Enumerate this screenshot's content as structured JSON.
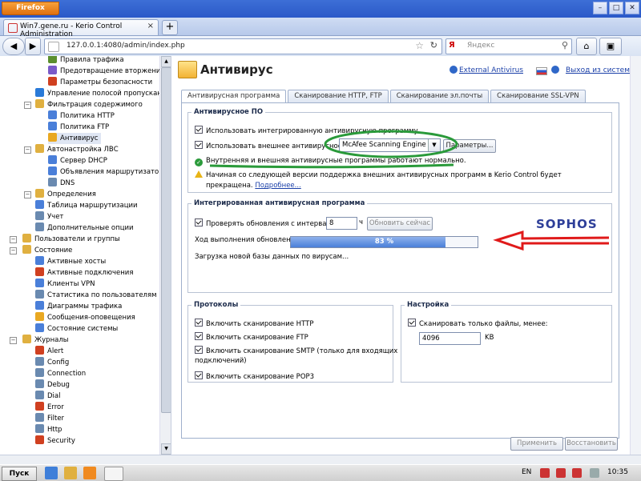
{
  "browser": {
    "button_label": "Firefox",
    "tab_title": "Win7.gene.ru - Kerio Control Administration",
    "url": "127.0.0.1:4080/admin/index.php",
    "search_placeholder": "Яндекс",
    "search_engine_letter": "Я"
  },
  "tree": {
    "items": [
      {
        "label": "Правила трафика",
        "color": "#5b8f2d"
      },
      {
        "label": "Предотвращение вторжения",
        "color": "#7a5ac8"
      },
      {
        "label": "Параметры безопасности",
        "color": "#d04020"
      },
      {
        "label": "Управление полосой пропускания и",
        "color": "#2a7ad8"
      },
      {
        "label": "Фильтрация содержимого",
        "color": "#e0b040"
      },
      {
        "label": "Политика HTTP",
        "color": "#4a7fd9"
      },
      {
        "label": "Политика FTP",
        "color": "#4a7fd9"
      },
      {
        "label": "Антивирус",
        "color": "#e9a821"
      },
      {
        "label": "Автонастройка ЛВС",
        "color": "#e0b040"
      },
      {
        "label": "Сервер DHCP",
        "color": "#4a7fd9"
      },
      {
        "label": "Объявления маршрутизатора IP",
        "color": "#4a7fd9"
      },
      {
        "label": "DNS",
        "color": "#6a8ab0"
      },
      {
        "label": "Определения",
        "color": "#e0b040"
      },
      {
        "label": "Таблица маршрутизации",
        "color": "#4a7fd9"
      },
      {
        "label": "Учет",
        "color": "#6a8ab0"
      },
      {
        "label": "Дополнительные опции",
        "color": "#6a8ab0"
      },
      {
        "label": "Пользователи и группы",
        "color": "#e0b040"
      },
      {
        "label": "Состояние",
        "color": "#e0b040"
      },
      {
        "label": "Активные хосты",
        "color": "#4a7fd9"
      },
      {
        "label": "Активные подключения",
        "color": "#d04020"
      },
      {
        "label": "Клиенты VPN",
        "color": "#4a7fd9"
      },
      {
        "label": "Статистика по пользователям",
        "color": "#6a8ab0"
      },
      {
        "label": "Диаграммы трафика",
        "color": "#4a7fd9"
      },
      {
        "label": "Сообщения-оповещения",
        "color": "#e9a821"
      },
      {
        "label": "Состояние системы",
        "color": "#4a7fd9"
      },
      {
        "label": "Журналы",
        "color": "#e0b040"
      },
      {
        "label": "Alert",
        "color": "#d04020"
      },
      {
        "label": "Config",
        "color": "#6a8ab0"
      },
      {
        "label": "Connection",
        "color": "#6a8ab0"
      },
      {
        "label": "Debug",
        "color": "#6a8ab0"
      },
      {
        "label": "Dial",
        "color": "#6a8ab0"
      },
      {
        "label": "Error",
        "color": "#d04020"
      },
      {
        "label": "Filter",
        "color": "#6a8ab0"
      },
      {
        "label": "Http",
        "color": "#6a8ab0"
      },
      {
        "label": "Security",
        "color": "#d04020"
      }
    ]
  },
  "page": {
    "title": "Антивирус",
    "external_antivirus_link": "External Antivirus",
    "logout_link": "Выход из системы"
  },
  "tabs": [
    "Антивирусная программа",
    "Сканирование HTTP, FTP",
    "Сканирование эл.почты",
    "Сканирование SSL-VPN"
  ],
  "antivirus_group": {
    "legend": "Антивирусное ПО",
    "use_integrated": "Использовать интегрированную антивирусную программу",
    "use_external": "Использовать внешнее антивирусное ПО",
    "external_selected": "McAfee Scanning Engine",
    "params_button": "Параметры...",
    "status_ok": "Внутренняя и внешняя антивирусные программы работают нормально.",
    "warning_line1": "Начиная со следующей версии поддержка внешних антивирусных программ в Kerio Control будет",
    "warning_line2": "прекращена.",
    "more_link": "Подробнее..."
  },
  "integrated_group": {
    "legend": "Интегрированная антивирусная программа",
    "check_updates": "Проверять обновления с интервалом",
    "interval_value": "8",
    "interval_unit": "ч",
    "update_now_button": "Обновить сейчас",
    "progress_label": "Ход выполнения обновления:",
    "progress_percent": 83,
    "progress_text": "83 %",
    "status_text": "Загрузка новой базы данных по вирусам...",
    "vendor_logo": "SOPHOS"
  },
  "protocols_group": {
    "legend": "Протоколы",
    "items": [
      "Включить сканирование HTTP",
      "Включить сканирование FTP",
      "Включить сканирование SMTP (только для входящих",
      "Включить сканирование POP3"
    ],
    "smtp_line2": "подключений)"
  },
  "settings_group": {
    "legend": "Настройка",
    "scan_only_smaller": "Сканировать только файлы, менее:",
    "size_value": "4096",
    "size_unit": "KB"
  },
  "footer": {
    "apply_button": "Применить",
    "restore_button": "Восстановить"
  },
  "taskbar": {
    "start_label": "Пуск",
    "lang": "EN",
    "clock": "10:35"
  },
  "colors": {
    "annotation_green": "#2a9a3a",
    "annotation_red": "#e01a1a",
    "link_blue": "#1a3fa8"
  }
}
